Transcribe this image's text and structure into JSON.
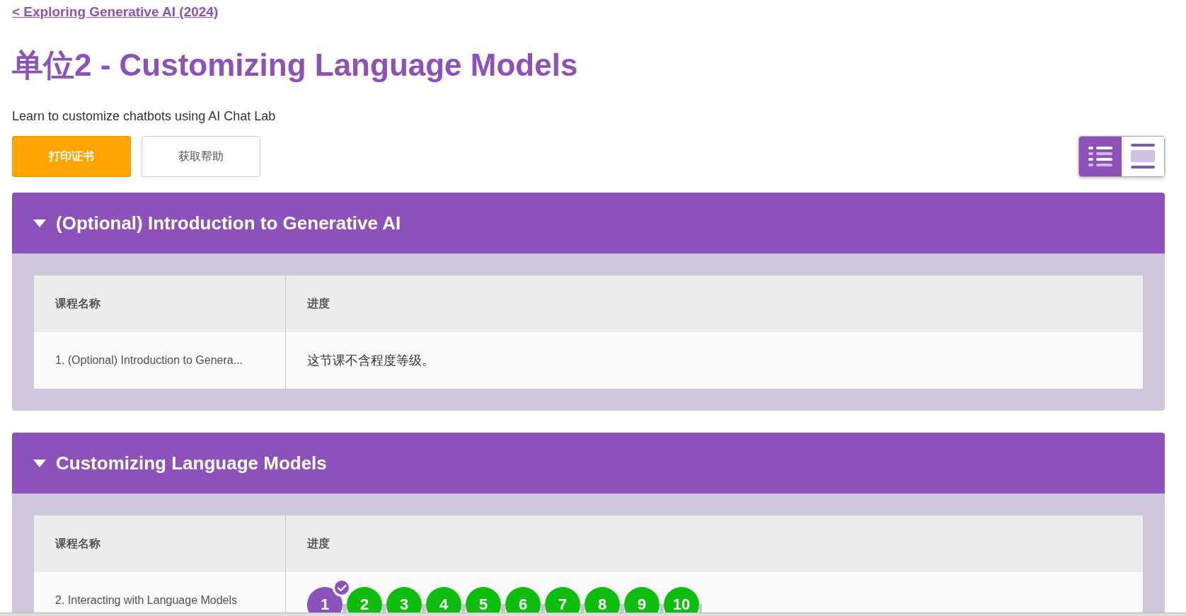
{
  "back_link": "< Exploring Generative AI (2024)",
  "title": "单位2 - Customizing Language Models",
  "description": "Learn to customize chatbots using AI Chat Lab",
  "buttons": [
    {
      "label": "打印证书",
      "kind": "primary"
    },
    {
      "label": "获取帮助",
      "kind": "secondary"
    }
  ],
  "view_toggle": [
    {
      "kind": "detail",
      "selected": true
    },
    {
      "kind": "summary",
      "selected": false
    }
  ],
  "sections": [
    {
      "title": "(Optional) Introduction to Generative AI",
      "expanded": true,
      "columns": [
        "课程名称",
        "进度"
      ],
      "rows": [
        {
          "name": "1. (Optional) Introduction to Genera...",
          "note": "这节课不含程度等级。",
          "bubbles": []
        }
      ]
    },
    {
      "title": "Customizing Language Models",
      "expanded": true,
      "columns": [
        "课程名称",
        "进度"
      ],
      "rows": [
        {
          "name": "2. Interacting with Language Models",
          "bubbles": [
            {
              "label": "1",
              "kind": "assessment",
              "checked": true
            },
            {
              "label": "2",
              "kind": "lesson",
              "checked": false
            },
            {
              "label": "3",
              "kind": "lesson",
              "checked": false
            },
            {
              "label": "4",
              "kind": "lesson",
              "checked": false
            },
            {
              "label": "5",
              "kind": "lesson",
              "checked": false
            },
            {
              "label": "6",
              "kind": "lesson",
              "checked": false
            },
            {
              "label": "7",
              "kind": "lesson",
              "checked": false
            },
            {
              "label": "8",
              "kind": "lesson",
              "checked": false
            },
            {
              "label": "9",
              "kind": "lesson",
              "checked": false
            },
            {
              "label": "10",
              "kind": "lesson",
              "checked": false
            }
          ]
        }
      ]
    }
  ]
}
